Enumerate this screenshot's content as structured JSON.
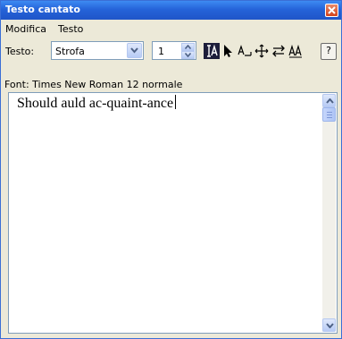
{
  "window": {
    "title": "Testo cantato"
  },
  "menubar": {
    "items": [
      "Modifica",
      "Testo"
    ]
  },
  "toolbar": {
    "text_label": "Testo:",
    "text_type_value": "Strofa",
    "verse_number": "1",
    "tools": [
      "text-cursor-tool",
      "select-arrow-tool",
      "underline-extender-tool",
      "move-tool",
      "swap-tool",
      "resize-text-tool"
    ],
    "help_label": "?"
  },
  "font_info": "Font:  Times New Roman 12 normale",
  "editor": {
    "content": "Should auld ac-quaint-ance"
  },
  "colors": {
    "titlebar": "#2563d9",
    "window_bg": "#ece9d8",
    "active_tool": "#1d1d3a"
  }
}
